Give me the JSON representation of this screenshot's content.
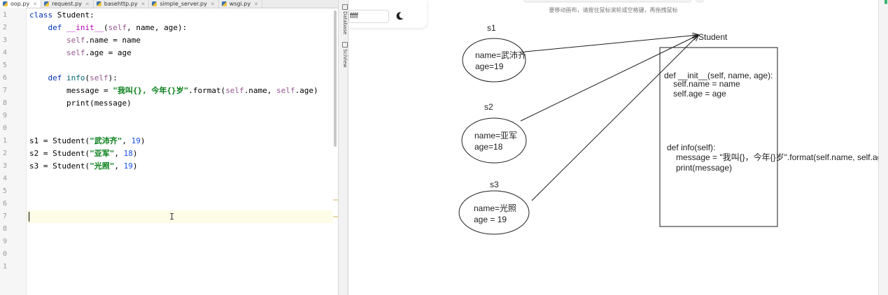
{
  "ide": {
    "tabs": [
      {
        "label": "oop.py",
        "active": true
      },
      {
        "label": "request.py",
        "active": false
      },
      {
        "label": "basehttp.py",
        "active": false
      },
      {
        "label": "simple_server.py",
        "active": false
      },
      {
        "label": "wsgi.py",
        "active": false
      }
    ],
    "line_numbers": [
      "1",
      "2",
      "3",
      "4",
      "5",
      "6",
      "7",
      "8",
      "9",
      "0",
      "1",
      "2",
      "3",
      "4",
      "5",
      "6",
      "7",
      "8",
      "9",
      "0",
      "1"
    ],
    "code": {
      "l1_kw": "class",
      "l1_name": " Student:",
      "l2_kw": "def",
      "l2_fn": "__init__",
      "l2_open": "(",
      "l2_self": "self",
      "l2_rest": ", name, age):",
      "l3_self": "self",
      "l3_rest": ".name = name",
      "l4_self": "self",
      "l4_rest": ".age = age",
      "l6_kw": "def",
      "l6_fn": "info",
      "l6_open": "(",
      "l6_self": "self",
      "l6_rest": "):",
      "l7_var": "message = ",
      "l7_str": "\"我叫{}, 今年{}岁\"",
      "l7_mid": ".format(",
      "l7_self1": "self",
      "l7_mid2": ".name, ",
      "l7_self2": "self",
      "l7_end": ".age)",
      "l8": "print(message)",
      "l11_pre": "s1 = Student(",
      "l11_str": "\"武沛齐\"",
      "l11_sep": ", ",
      "l11_num": "19",
      "l11_end": ")",
      "l12_pre": "s2 = Student(",
      "l12_str": "\"亚军\"",
      "l12_sep": ", ",
      "l12_num": "18",
      "l12_end": ")",
      "l13_pre": "s3 = Student(",
      "l13_str": "\"光照\"",
      "l13_sep": ", ",
      "l13_num": "19",
      "l13_end": ")"
    },
    "side_tabs": {
      "database": "Database",
      "sciview": "SciView"
    },
    "ibeam": "I"
  },
  "board": {
    "color_value": "ffff",
    "hint": "要移动画布，请按住鼠标滚轮或空格键，再拖拽鼠标",
    "labels": {
      "s1": "s1",
      "s2": "s2",
      "s3": "s3",
      "student": "Student"
    },
    "obj1": {
      "name": "name=武沛齐",
      "age": "age=19"
    },
    "obj2": {
      "name": "name=亚军",
      "age": "age=18"
    },
    "obj3": {
      "name": "name=光照",
      "age": "age = 19"
    },
    "class_box": {
      "init_sig": "def __init__(self, name, age):",
      "init_l1": "self.name = name",
      "init_l2": "self.age = age",
      "info_sig": "def info(self):",
      "info_l1": "message = \"我叫{}，今年{}岁\".format(self.name, self.age)",
      "info_l2": "print(message)"
    },
    "colors": {
      "stroke": "#1e1e1e",
      "accent_green": "#3cb371"
    }
  }
}
